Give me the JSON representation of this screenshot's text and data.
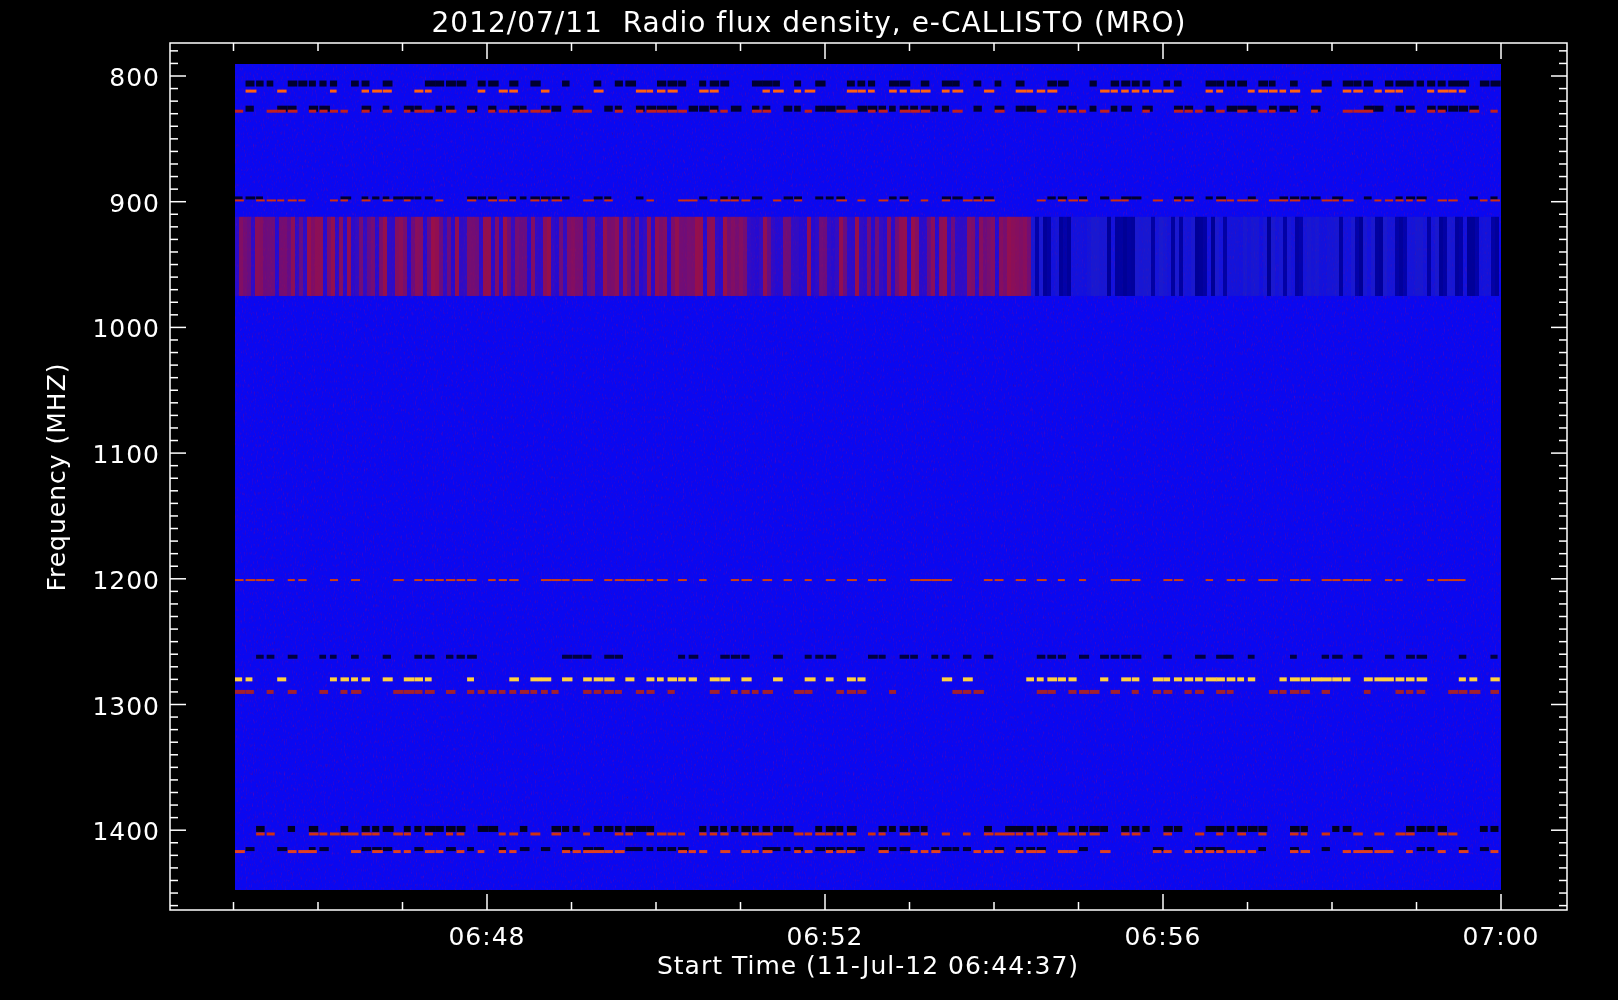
{
  "title": "2012/07/11  Radio flux density, e-CALLISTO (MRO)",
  "plot": {
    "ylabel": "Frequency (MHZ)",
    "xlabel": "Start Time (11-Jul-12 06:44:37)",
    "yticks": [
      "800",
      "900",
      "1000",
      "1100",
      "1200",
      "1300",
      "1400"
    ],
    "xticks": [
      "06:48",
      "06:52",
      "06:56",
      "07:00"
    ]
  }
}
